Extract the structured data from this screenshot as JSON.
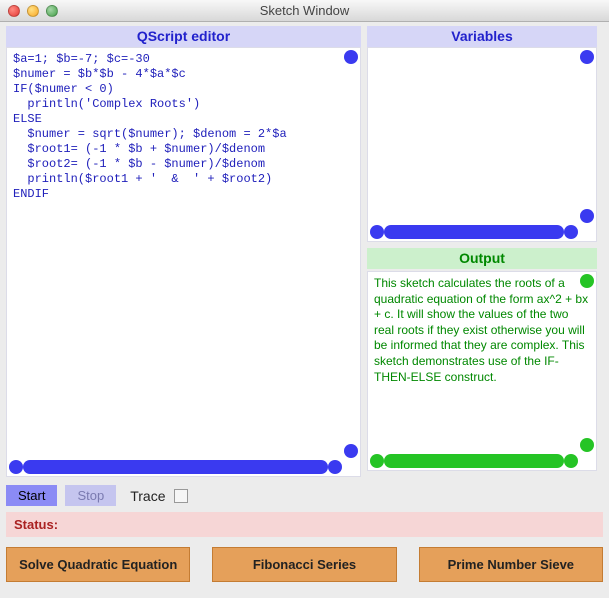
{
  "window": {
    "title": "Sketch Window"
  },
  "editor": {
    "header": "QScript editor",
    "code": "$a=1; $b=-7; $c=-30\n$numer = $b*$b - 4*$a*$c\nIF($numer < 0)\n  println('Complex Roots')\nELSE\n  $numer = sqrt($numer); $denom = 2*$a\n  $root1= (-1 * $b + $numer)/$denom\n  $root2= (-1 * $b - $numer)/$denom\n  println($root1 + '  &  ' + $root2)\nENDIF"
  },
  "variables": {
    "header": "Variables"
  },
  "output": {
    "header": "Output",
    "text": "This sketch calculates the roots of a quadratic equation of the form ax^2 + bx + c. It will show the values of the two real roots if they exist otherwise you will  be informed that they are complex. This sketch demonstrates use of the IF-THEN-ELSE construct."
  },
  "controls": {
    "start": "Start",
    "stop": "Stop",
    "trace": "Trace"
  },
  "status": {
    "label": "Status:"
  },
  "buttons": {
    "quad": "Solve Quadratic Equation",
    "fib": "Fibonacci Series",
    "sieve": "Prime Number Sieve"
  }
}
